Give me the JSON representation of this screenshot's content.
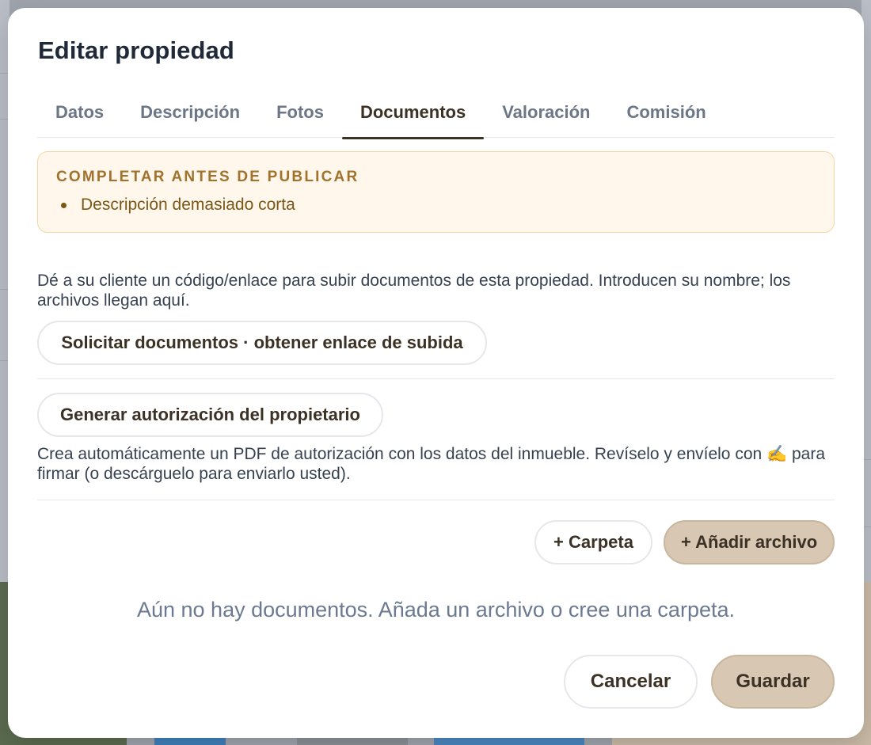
{
  "modal": {
    "title": "Editar propiedad",
    "tabs": [
      {
        "label": "Datos",
        "active": false
      },
      {
        "label": "Descripción",
        "active": false
      },
      {
        "label": "Fotos",
        "active": false
      },
      {
        "label": "Documentos",
        "active": true
      },
      {
        "label": "Valoración",
        "active": false
      },
      {
        "label": "Comisión",
        "active": false
      }
    ],
    "warning": {
      "title": "COMPLETAR ANTES DE PUBLICAR",
      "items": [
        "Descripción demasiado corta"
      ]
    },
    "upload_request": {
      "description": "Dé a su cliente un código/enlace para subir documentos de esta propiedad. Introducen su nombre; los archivos llegan aquí.",
      "button_label": "Solicitar documentos · obtener enlace de subida"
    },
    "authorization": {
      "button_label": "Generar autorización del propietario",
      "description": "Crea automáticamente un PDF de autorización con los datos del inmueble. Revíselo y envíelo con ✍️ para firmar (o descárguelo para enviarlo usted)."
    },
    "documents": {
      "add_folder_label": "+ Carpeta",
      "add_file_label": "+ Añadir archivo",
      "empty_message": "Aún no hay documentos. Añada un archivo o cree una carpeta."
    },
    "footer": {
      "cancel_label": "Cancelar",
      "save_label": "Guardar"
    }
  },
  "colors": {
    "accent": "#3b3124",
    "primary_soft": "#d8c8b3",
    "warning_bg": "#fff7ec",
    "warning_border": "#f5d5a6",
    "warning_text": "#a0722c"
  }
}
